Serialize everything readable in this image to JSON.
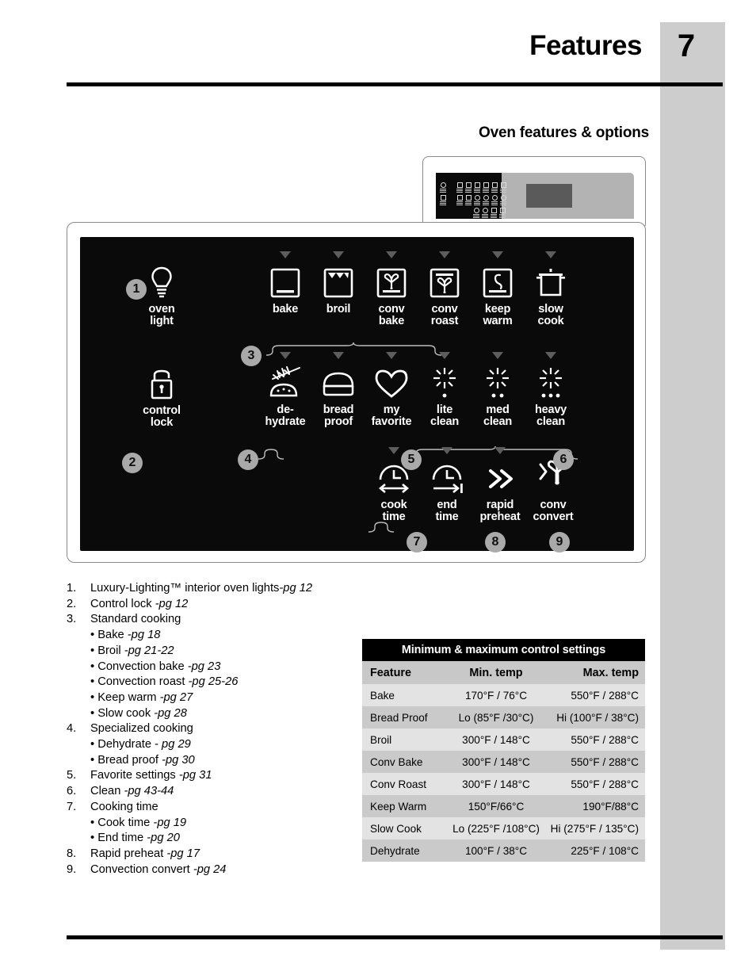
{
  "header": {
    "title": "Features",
    "page_number": "7",
    "section_title": "Oven features & options"
  },
  "panel": {
    "buttons_row1": [
      {
        "id": "oven-light",
        "label": "oven\nlight",
        "icon": "lightbulb-icon",
        "caret": false
      },
      {
        "id": "bake",
        "label": "bake",
        "icon": "bake-icon",
        "caret": true
      },
      {
        "id": "broil",
        "label": "broil",
        "icon": "broil-icon",
        "caret": true
      },
      {
        "id": "conv-bake",
        "label": "conv\nbake",
        "icon": "convection-bake-icon",
        "caret": true
      },
      {
        "id": "conv-roast",
        "label": "conv\nroast",
        "icon": "convection-roast-icon",
        "caret": true
      },
      {
        "id": "keep-warm",
        "label": "keep\nwarm",
        "icon": "keep-warm-icon",
        "caret": true
      },
      {
        "id": "slow-cook",
        "label": "slow\ncook",
        "icon": "slow-cook-icon",
        "caret": true
      }
    ],
    "buttons_row2": [
      {
        "id": "control-lock",
        "label": "control\nlock",
        "icon": "padlock-icon",
        "caret": false
      },
      {
        "id": "dehydrate",
        "label": "de-\nhydrate",
        "icon": "dehydrate-icon",
        "caret": true
      },
      {
        "id": "bread-proof",
        "label": "bread\nproof",
        "icon": "bread-proof-icon",
        "caret": true
      },
      {
        "id": "my-favorite",
        "label": "my\nfavorite",
        "icon": "heart-icon",
        "caret": true
      },
      {
        "id": "lite-clean",
        "label": "lite\nclean",
        "icon": "clean-1-dot-icon",
        "caret": true
      },
      {
        "id": "med-clean",
        "label": "med\nclean",
        "icon": "clean-2-dot-icon",
        "caret": true
      },
      {
        "id": "heavy-clean",
        "label": "heavy\nclean",
        "icon": "clean-3-dot-icon",
        "caret": true
      }
    ],
    "buttons_row3": [
      {
        "id": "cook-time",
        "label": "cook\ntime",
        "icon": "cook-time-clock-icon",
        "caret": true
      },
      {
        "id": "end-time",
        "label": "end\ntime",
        "icon": "end-time-clock-icon",
        "caret": true
      },
      {
        "id": "rapid-preheat",
        "label": "rapid\npreheat",
        "icon": "double-chevron-icon",
        "caret": true
      },
      {
        "id": "conv-convert",
        "label": "conv\nconvert",
        "icon": "convection-convert-icon",
        "caret": false
      }
    ],
    "badges": [
      "1",
      "2",
      "3",
      "4",
      "5",
      "6",
      "7",
      "8",
      "9"
    ]
  },
  "feature_list": [
    {
      "num": "1.",
      "text": "Luxury-Lighting™ interior oven lights",
      "pg": "-pg 12",
      "subs": []
    },
    {
      "num": "2.",
      "text": "Control lock ",
      "pg": "-pg 12",
      "subs": []
    },
    {
      "num": "3.",
      "text": "Standard cooking",
      "pg": "",
      "subs": [
        {
          "text": "• Bake ",
          "pg": "-pg 18"
        },
        {
          "text": "• Broil ",
          "pg": "-pg 21-22"
        },
        {
          "text": "• Convection bake ",
          "pg": "-pg 23"
        },
        {
          "text": "• Convection roast ",
          "pg": "-pg 25-26"
        },
        {
          "text": "• Keep warm ",
          "pg": "-pg 27"
        },
        {
          "text": "• Slow cook ",
          "pg": "-pg 28"
        }
      ]
    },
    {
      "num": "4.",
      "text": "Specialized cooking",
      "pg": "",
      "subs": [
        {
          "text": "• Dehydrate - ",
          "pg": "pg 29"
        },
        {
          "text": "• Bread proof  ",
          "pg": "-pg 30"
        }
      ]
    },
    {
      "num": "5.",
      "text": "Favorite settings ",
      "pg": "-pg 31",
      "subs": []
    },
    {
      "num": "6.",
      "text": "Clean ",
      "pg": "-pg 43-44",
      "subs": []
    },
    {
      "num": "7.",
      "text": "Cooking time",
      "pg": "",
      "subs": [
        {
          "text": "• Cook time ",
          "pg": "-pg 19"
        },
        {
          "text": "• End time ",
          "pg": "-pg 20"
        }
      ]
    },
    {
      "num": "8.",
      "text": " Rapid preheat ",
      "pg": "-pg 17",
      "subs": []
    },
    {
      "num": "9.",
      "text": "Convection convert ",
      "pg": "-pg 24",
      "subs": []
    }
  ],
  "table": {
    "title": "Minimum & maximum control settings",
    "headers": [
      "Feature",
      "Min. temp",
      "Max. temp"
    ],
    "rows": [
      [
        "Bake",
        "170°F / 76°C",
        "550°F / 288°C"
      ],
      [
        "Bread Proof",
        "Lo (85°F /30°C)",
        "Hi (100°F / 38°C)"
      ],
      [
        "Broil",
        "300°F / 148°C",
        "550°F / 288°C"
      ],
      [
        "Conv Bake",
        "300°F / 148°C",
        "550°F / 288°C"
      ],
      [
        "Conv Roast",
        "300°F / 148°C",
        "550°F / 288°C"
      ],
      [
        "Keep  Warm",
        "150°F/66°C",
        "190°F/88°C"
      ],
      [
        "Slow Cook",
        "Lo (225°F /108°C)",
        "Hi (275°F / 135°C)"
      ],
      [
        "Dehydrate",
        "100°F / 38°C",
        "225°F / 108°C"
      ]
    ]
  },
  "colors": {
    "sidebar": "#cdcdcd",
    "panel_dark": "#0a0a0a",
    "badge": "#a9a9a9",
    "table_header": "#c8c8c8",
    "row_light": "#e3e3e3",
    "row_dark": "#cacaca"
  }
}
